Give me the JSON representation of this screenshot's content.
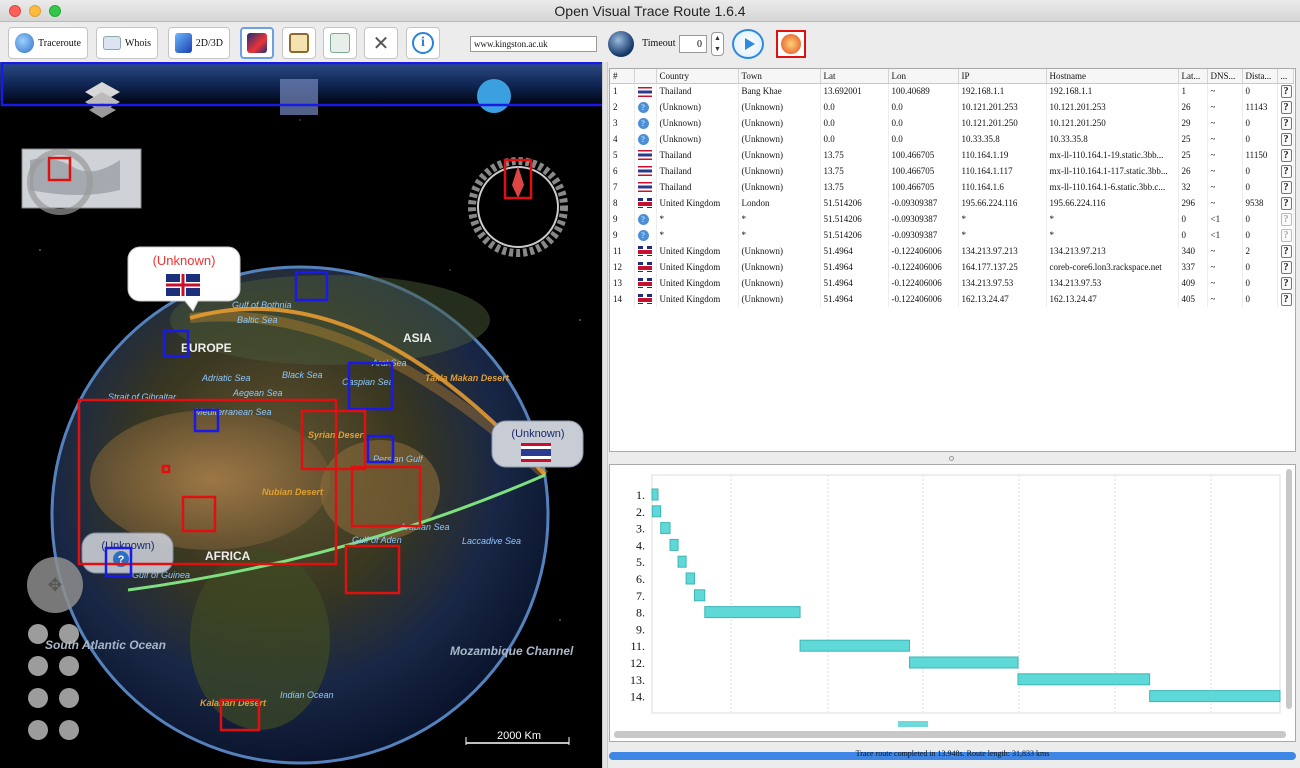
{
  "window": {
    "title": "Open Visual Trace Route 1.6.4"
  },
  "toolbar": {
    "traceroute_label": "Traceroute",
    "whois_label": "Whois",
    "mode_label": "2D/3D",
    "url_value": "www.kingston.ac.uk",
    "timeout_label": "Timeout",
    "timeout_value": "0"
  },
  "map": {
    "continents": [
      "EUROPE",
      "ASIA",
      "AFRICA"
    ],
    "places": [
      "Gulf of Bothnia",
      "Baltic Sea",
      "Adriatic Sea",
      "Black Sea",
      "Caspian Sea",
      "Aral Sea",
      "Takla Makan Desert",
      "Strait of Gibraltar",
      "Aegean Sea",
      "Mediterranean Sea",
      "Syrian Desert",
      "Persian Gulf",
      "Nubian Desert",
      "Arabian Sea",
      "Gulf of Aden",
      "Laccadive Sea",
      "Gulf of Guinea",
      "South Atlantic Ocean",
      "Indian Ocean",
      "Mozambique Channel",
      "Kalahari Desert"
    ],
    "callouts": [
      "(Unknown)",
      "(Unknown)",
      "(Unknown)"
    ],
    "unknown_marker": "?",
    "scale_label": "2000 Km"
  },
  "table": {
    "columns": [
      "#",
      "",
      "Country",
      "Town",
      "Lat",
      "Lon",
      "IP",
      "Hostname",
      "Lat...",
      "DNS...",
      "Dista...",
      "..."
    ],
    "rows": [
      {
        "n": "1",
        "flag": "th",
        "country": "Thailand",
        "town": "Bang Khae",
        "lat": "13.692001",
        "lon": "100.40689",
        "ip": "192.168.1.1",
        "host": "192.168.1.1",
        "latency": "1",
        "dns": "~",
        "dist": "0",
        "q": "?"
      },
      {
        "n": "2",
        "flag": "unk",
        "country": "(Unknown)",
        "town": "(Unknown)",
        "lat": "0.0",
        "lon": "0.0",
        "ip": "10.121.201.253",
        "host": "10.121.201.253",
        "latency": "26",
        "dns": "~",
        "dist": "11143",
        "q": "?"
      },
      {
        "n": "3",
        "flag": "unk",
        "country": "(Unknown)",
        "town": "(Unknown)",
        "lat": "0.0",
        "lon": "0.0",
        "ip": "10.121.201.250",
        "host": "10.121.201.250",
        "latency": "29",
        "dns": "~",
        "dist": "0",
        "q": "?"
      },
      {
        "n": "4",
        "flag": "unk",
        "country": "(Unknown)",
        "town": "(Unknown)",
        "lat": "0.0",
        "lon": "0.0",
        "ip": "10.33.35.8",
        "host": "10.33.35.8",
        "latency": "25",
        "dns": "~",
        "dist": "0",
        "q": "?"
      },
      {
        "n": "5",
        "flag": "th",
        "country": "Thailand",
        "town": "(Unknown)",
        "lat": "13.75",
        "lon": "100.466705",
        "ip": "110.164.1.19",
        "host": "mx-ll-110.164.1-19.static.3bb...",
        "latency": "25",
        "dns": "~",
        "dist": "11150",
        "q": "?"
      },
      {
        "n": "6",
        "flag": "th",
        "country": "Thailand",
        "town": "(Unknown)",
        "lat": "13.75",
        "lon": "100.466705",
        "ip": "110.164.1.117",
        "host": "mx-ll-110.164.1-117.static.3bb...",
        "latency": "26",
        "dns": "~",
        "dist": "0",
        "q": "?"
      },
      {
        "n": "7",
        "flag": "th",
        "country": "Thailand",
        "town": "(Unknown)",
        "lat": "13.75",
        "lon": "100.466705",
        "ip": "110.164.1.6",
        "host": "mx-ll-110.164.1-6.static.3bb.c...",
        "latency": "32",
        "dns": "~",
        "dist": "0",
        "q": "?"
      },
      {
        "n": "8",
        "flag": "uk",
        "country": "United Kingdom",
        "town": "London",
        "lat": "51.514206",
        "lon": "-0.09309387",
        "ip": "195.66.224.116",
        "host": "195.66.224.116",
        "latency": "296",
        "dns": "~",
        "dist": "9538",
        "q": "?"
      },
      {
        "n": "9",
        "flag": "unk",
        "country": "*",
        "town": "*",
        "lat": "51.514206",
        "lon": "-0.09309387",
        "ip": "*",
        "host": "*",
        "latency": "0",
        "dns": "<1",
        "dist": "0",
        "q": "?"
      },
      {
        "n": "9",
        "flag": "unk",
        "country": "*",
        "town": "*",
        "lat": "51.514206",
        "lon": "-0.09309387",
        "ip": "*",
        "host": "*",
        "latency": "0",
        "dns": "<1",
        "dist": "0",
        "q": "?"
      },
      {
        "n": "11",
        "flag": "uk",
        "country": "United Kingdom",
        "town": "(Unknown)",
        "lat": "51.4964",
        "lon": "-0.122406006",
        "ip": "134.213.97.213",
        "host": "134.213.97.213",
        "latency": "340",
        "dns": "~",
        "dist": "2",
        "q": "?"
      },
      {
        "n": "12",
        "flag": "uk",
        "country": "United Kingdom",
        "town": "(Unknown)",
        "lat": "51.4964",
        "lon": "-0.122406006",
        "ip": "164.177.137.25",
        "host": "coreb-core6.lon3.rackspace.net",
        "latency": "337",
        "dns": "~",
        "dist": "0",
        "q": "?"
      },
      {
        "n": "13",
        "flag": "uk",
        "country": "United Kingdom",
        "town": "(Unknown)",
        "lat": "51.4964",
        "lon": "-0.122406006",
        "ip": "134.213.97.53",
        "host": "134.213.97.53",
        "latency": "409",
        "dns": "~",
        "dist": "0",
        "q": "?"
      },
      {
        "n": "14",
        "flag": "uk",
        "country": "United Kingdom",
        "town": "(Unknown)",
        "lat": "51.4964",
        "lon": "-0.122406006",
        "ip": "162.13.24.47",
        "host": "162.13.24.47",
        "latency": "405",
        "dns": "~",
        "dist": "0",
        "q": "?"
      }
    ]
  },
  "gantt": {
    "labels": [
      "1.",
      "2.",
      "3.",
      "4.",
      "5.",
      "6.",
      "7.",
      "8.",
      "9.",
      "11.",
      "12.",
      "13.",
      "14."
    ],
    "start": [
      0,
      1,
      27,
      56,
      81,
      106,
      132,
      164,
      460,
      460,
      800,
      1137,
      1546
    ],
    "duration": [
      1,
      26,
      29,
      25,
      25,
      26,
      32,
      296,
      0,
      340,
      337,
      409,
      405
    ]
  },
  "status": {
    "text": "Trace route completed in 13.948s. Route length: 31,833 kms"
  },
  "colors": {
    "bar": "#5fd8d8",
    "progress": "#3d86e6",
    "highlight_red": "#e01010",
    "highlight_blue": "#1a1ae6"
  }
}
